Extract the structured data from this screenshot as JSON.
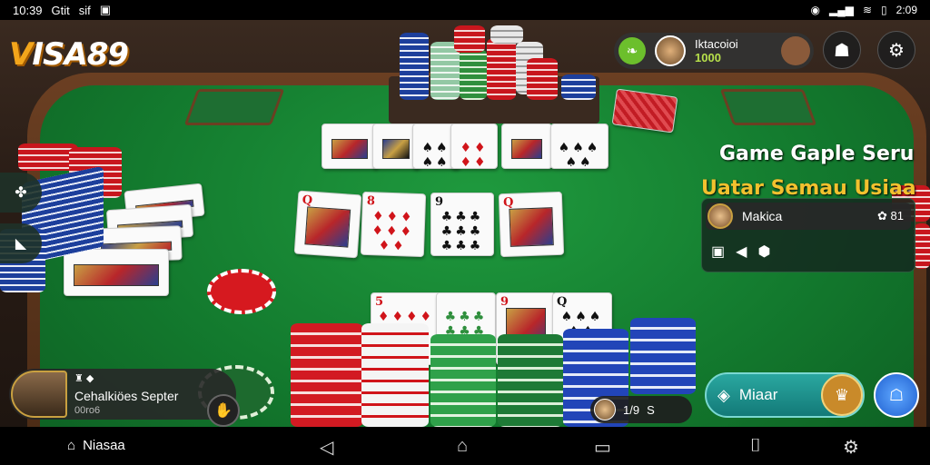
{
  "status_bar": {
    "time_left": "10:39",
    "carrier": "Gtit",
    "signal_label": "sif",
    "time_right": "2:09"
  },
  "app": {
    "logo_prefix": "V",
    "logo_rest": "ISA89"
  },
  "profile": {
    "name": "Iktacoioi",
    "coins": "1000"
  },
  "promo": {
    "line1": "Game Gaple Seru",
    "line2": "Uatar Semau Usiaa"
  },
  "info_panel": {
    "name": "Makica",
    "stat": "81"
  },
  "player": {
    "name": "Cehalkiöes Septer",
    "coins": "00ro6"
  },
  "counter": {
    "value": "1/9",
    "suffix": "S"
  },
  "play_button": {
    "label": "Miaar"
  },
  "nav": {
    "home_label": "Niasaa"
  },
  "icons": {
    "profile_green": "leaf-icon",
    "account": "person-icon",
    "settings": "gear-icon",
    "back": "triangle-back-icon",
    "home": "home-icon",
    "recents": "square-icon",
    "extra": "bracket-icon",
    "nav_settings": "cog-icon"
  },
  "colors": {
    "felt": "#1f9a3e",
    "accent_gold": "#f2c12e",
    "play_teal": "#2aa7a0"
  }
}
